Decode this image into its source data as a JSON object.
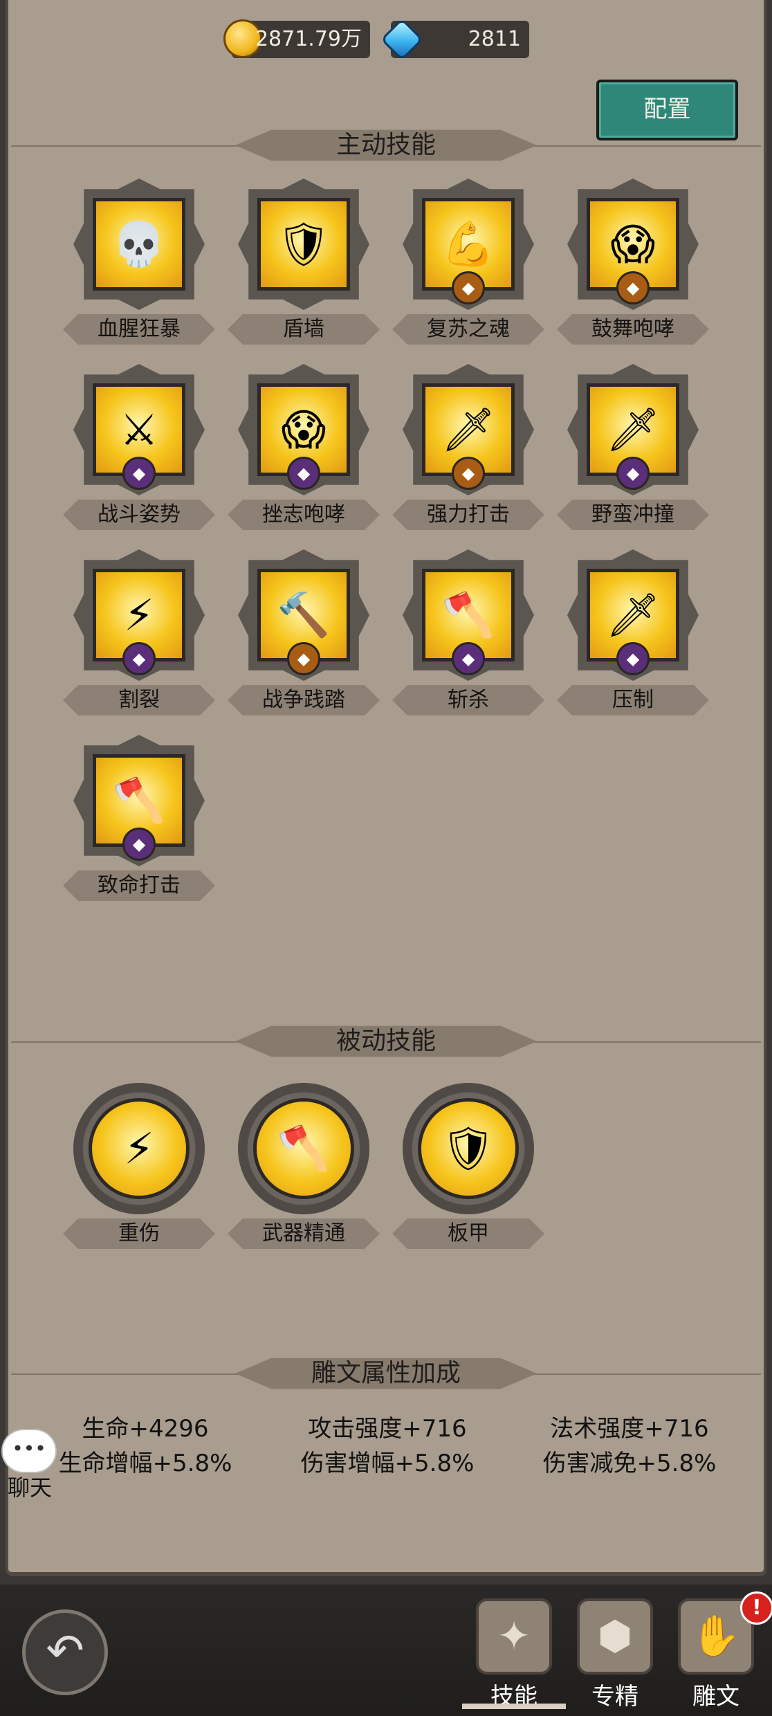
{
  "currency": {
    "gold": "2871.79万",
    "gems": "2811"
  },
  "config_button": "配置",
  "sections": {
    "active": "主动技能",
    "passive": "被动技能",
    "rune": "雕文属性加成"
  },
  "active_skills": [
    {
      "name": "血腥狂暴",
      "icon": "skull-icon",
      "art": "💀",
      "badge": ""
    },
    {
      "name": "盾墙",
      "icon": "shield-icon",
      "art": "🛡",
      "badge": ""
    },
    {
      "name": "复苏之魂",
      "icon": "spirit-icon",
      "art": "💪",
      "badge": "orange"
    },
    {
      "name": "鼓舞咆哮",
      "icon": "roar-icon",
      "art": "😱",
      "badge": "orange"
    },
    {
      "name": "战斗姿势",
      "icon": "crossed-axes-icon",
      "art": "⚔",
      "badge": "purple"
    },
    {
      "name": "挫志咆哮",
      "icon": "roar-icon",
      "art": "😱",
      "badge": "purple"
    },
    {
      "name": "强力打击",
      "icon": "blade-icon",
      "art": "🗡",
      "badge": "orange"
    },
    {
      "name": "野蛮冲撞",
      "icon": "charge-icon",
      "art": "🗡",
      "badge": "purple"
    },
    {
      "name": "割裂",
      "icon": "slash-icon",
      "art": "⚡",
      "badge": "purple"
    },
    {
      "name": "战争践踏",
      "icon": "hammer-icon",
      "art": "🔨",
      "badge": "orange"
    },
    {
      "name": "斩杀",
      "icon": "axe-icon",
      "art": "🪓",
      "badge": "purple"
    },
    {
      "name": "压制",
      "icon": "sword-icon",
      "art": "🗡",
      "badge": "purple"
    },
    {
      "name": "致命打击",
      "icon": "axe-icon",
      "art": "🪓",
      "badge": "purple"
    }
  ],
  "passive_skills": [
    {
      "name": "重伤",
      "icon": "slash-icon",
      "art": "⚡"
    },
    {
      "name": "武器精通",
      "icon": "axe-icon",
      "art": "🪓"
    },
    {
      "name": "板甲",
      "icon": "armor-icon",
      "art": "🛡"
    }
  ],
  "stats": [
    [
      "生命+4296",
      "生命增幅+5.8%"
    ],
    [
      "攻击强度+716",
      "伤害增幅+5.8%"
    ],
    [
      "法术强度+716",
      "伤害减免+5.8%"
    ]
  ],
  "chat": {
    "bubble": "•••",
    "label": "聊天"
  },
  "tabs": [
    {
      "label": "技能",
      "icon": "skill-tab-icon",
      "art": "✦",
      "active": true
    },
    {
      "label": "专精",
      "icon": "specialization-tab-icon",
      "art": "⬢",
      "active": false
    },
    {
      "label": "雕文",
      "icon": "glyph-tab-icon",
      "art": "✋",
      "active": false,
      "alert": "!"
    }
  ]
}
